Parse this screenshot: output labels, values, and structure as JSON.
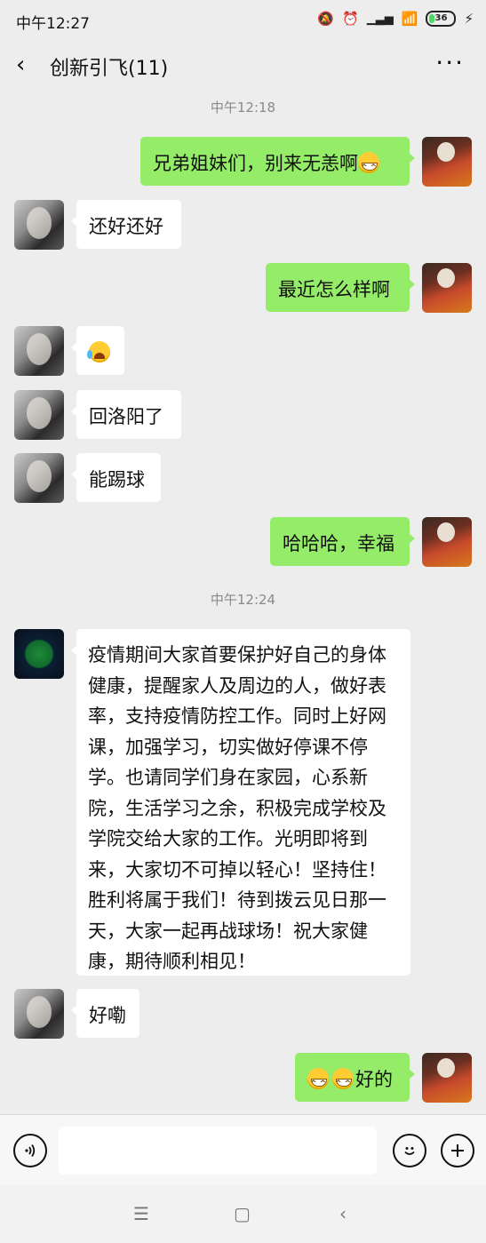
{
  "status": {
    "time": "中午12:27",
    "battery": "36"
  },
  "header": {
    "title": "创新引飞(11)",
    "more": "···",
    "back": "‹"
  },
  "messages": {
    "ts1": "中午12:18",
    "ts2": "中午12:24",
    "m1": "兄弟姐妹们，别来无恙啊",
    "m2": "还好还好",
    "m3": "最近怎么样啊",
    "m5": "回洛阳了",
    "m6": "能踢球",
    "m7": "哈哈哈，幸福",
    "m8": "疫情期间大家首要保护好自己的身体健康，提醒家人及周边的人，做好表率，支持疫情防控工作。同时上好网课，加强学习，切实做好停课不停学。也请同学们身在家园，心系新院，生活学习之余，积极完成学校及学院交给大家的工作。光明即将到来，大家切不可掉以轻心！坚持住！胜利将属于我们！待到拨云见日那一天，大家一起再战球场！祝大家健康，期待顺利相见！",
    "m9": "好嘞",
    "m10": "好的"
  },
  "icons": {
    "emoji_grin": "grin-emoji",
    "emoji_cry": "laugh-cry-emoji",
    "voice": "voice-icon",
    "sticker": "smiley-icon",
    "plus": "plus-icon"
  },
  "colors": {
    "background": "#ededed",
    "my_bubble": "#95ec69",
    "their_bubble": "#ffffff",
    "timestamp": "#8a8a8a"
  }
}
